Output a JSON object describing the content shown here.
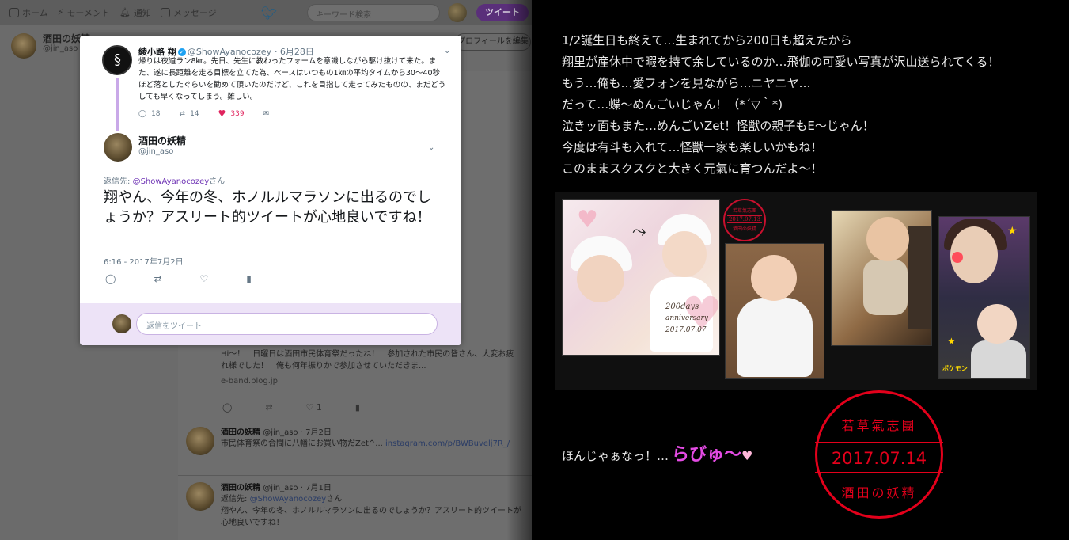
{
  "nav": {
    "home": "ホーム",
    "moments": "モーメント",
    "notifications": "通知",
    "messages": "メッセージ",
    "search_placeholder": "キーワード検索",
    "tweet_button": "ツイート"
  },
  "profile": {
    "name": "酒田の妖精",
    "handle": "@jin_aso",
    "edit_button": "プロフィールを編集"
  },
  "modal": {
    "parent": {
      "name": "綾小路 翔",
      "verified": "✓",
      "handle": "@ShowAyanocozey",
      "date": "· 6月28日",
      "body": "帰りは夜道ラン8㎞。先日、先生に教わったフォームを意識しながら駆け抜けて来た。また、遂に長距離を走る目標を立てた為、ペースはいつもの1㎞の平均タイムから30〜40秒ほど落としたぐらいを勧めて頂いたのだけど、これを目指して走ってみたものの、まだどうしても早くなってしまう。難しい。",
      "replies": "18",
      "retweets": "14",
      "likes": "339"
    },
    "main": {
      "name": "酒田の妖精",
      "handle": "@jin_aso",
      "reply_to_label": "返信先:",
      "reply_to_handle": "@ShowAyanocozey",
      "reply_to_suffix": "さん",
      "text": "翔やん、今年の冬、ホノルルマラソンに出るのでしょうか？アスリート的ツイートが心地良いですね！",
      "timestamp": "6:16 - 2017年7月2日"
    },
    "reply_placeholder": "返信をツイート"
  },
  "timeline": {
    "card": {
      "text1": "Hi〜！　日曜日は酒田市民体育祭だったね！　参加された市民の皆さん、大変お疲れ様でした！　俺も何年振りかで参加させていただきま...",
      "domain": "e-band.blog.jp",
      "likes": "1"
    },
    "tweets": [
      {
        "name": "酒田の妖精",
        "handle": "@jin_aso",
        "date": "· 7月2日",
        "body": "市民体育祭の合間に八幡にお買い物だZet^...",
        "link": "instagram.com/p/BWBuvelj7R_/"
      },
      {
        "name": "酒田の妖精",
        "handle": "@jin_aso",
        "date": "· 7月1日",
        "reply_to_label": "返信先:",
        "reply_to_handle": "@ShowAyanocozey",
        "reply_to_suffix": "さん",
        "body": "翔やん、今年の冬、ホノルルマラソンに出るのでしょうか？アスリート的ツイートが心地良いですね！"
      }
    ]
  },
  "message": {
    "lines": [
      "1/2誕生日も終えて…生まれてから200日も超えたから",
      "翔里が産休中で暇を持て余しているのか…飛伽の可愛い写真が沢山送られてくる！",
      "もう…俺も…愛フォンを見ながら…ニヤニヤ…",
      "だって…蝶〜めんごいじゃん！（*´▽｀*)",
      "泣きッ面もまた…めんごいZet！怪獣の親子もE〜じゃん！",
      "今度は有斗も入れて…怪獣一家も楽しいかもね！",
      "このままスクスクと大きく元氣に育つんだよ〜！"
    ],
    "closing": "ほんじゃぁなっ！…",
    "closing_love": "らびゅ〜",
    "closing_heart": "♥"
  },
  "collage": {
    "caption_line1": "200days",
    "caption_line2": "anniversary",
    "caption_line3": "2017.07.07",
    "small_stamp_top": "若草氣志團",
    "small_stamp_date": "2017.07.13",
    "small_stamp_bottom": "酒田の妖精",
    "pika_label": "ポケモン"
  },
  "stamp": {
    "top": "若草氣志團",
    "date": "2017.07.14",
    "bottom": "酒田の妖精"
  },
  "colors": {
    "accent_purple": "#5a2f7a",
    "like_red": "#e0245e",
    "stamp_red": "#e3001b",
    "love_pink": "#e44be4"
  }
}
